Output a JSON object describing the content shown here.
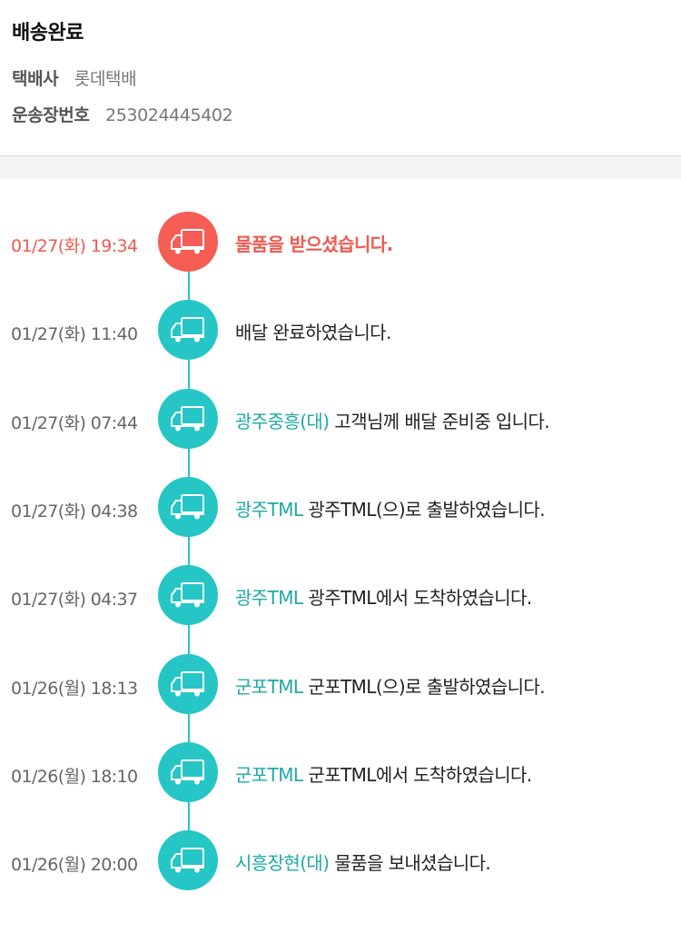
{
  "header": {
    "status": "배송완료",
    "carrier_label": "택배사",
    "carrier_value": "롯데택배",
    "tracking_label": "운송장번호",
    "tracking_value": "253024445402"
  },
  "colors": {
    "accent_teal": "#26c6c6",
    "location_teal": "#1eaaa6",
    "latest_red": "#f55d55"
  },
  "events": [
    {
      "time": "01/27(화) 19:34",
      "location": "",
      "message": "물품을 받으셨습니다.",
      "icon": "truck-icon"
    },
    {
      "time": "01/27(화) 11:40",
      "location": "",
      "message": "배달 완료하였습니다.",
      "icon": "truck-icon"
    },
    {
      "time": "01/27(화) 07:44",
      "location": "광주중흥(대)",
      "message": "고객님께 배달 준비중 입니다.",
      "icon": "truck-icon"
    },
    {
      "time": "01/27(화) 04:38",
      "location": "광주TML",
      "message": "광주TML(으)로 출발하였습니다.",
      "icon": "truck-icon"
    },
    {
      "time": "01/27(화) 04:37",
      "location": "광주TML",
      "message": "광주TML에서 도착하였습니다.",
      "icon": "truck-icon"
    },
    {
      "time": "01/26(월) 18:13",
      "location": "군포TML",
      "message": "군포TML(으)로 출발하였습니다.",
      "icon": "truck-icon"
    },
    {
      "time": "01/26(월) 18:10",
      "location": "군포TML",
      "message": "군포TML에서 도착하였습니다.",
      "icon": "truck-icon"
    },
    {
      "time": "01/26(월) 20:00",
      "location": "시흥장현(대)",
      "message": "물품을 보내셨습니다.",
      "icon": "truck-icon"
    }
  ]
}
